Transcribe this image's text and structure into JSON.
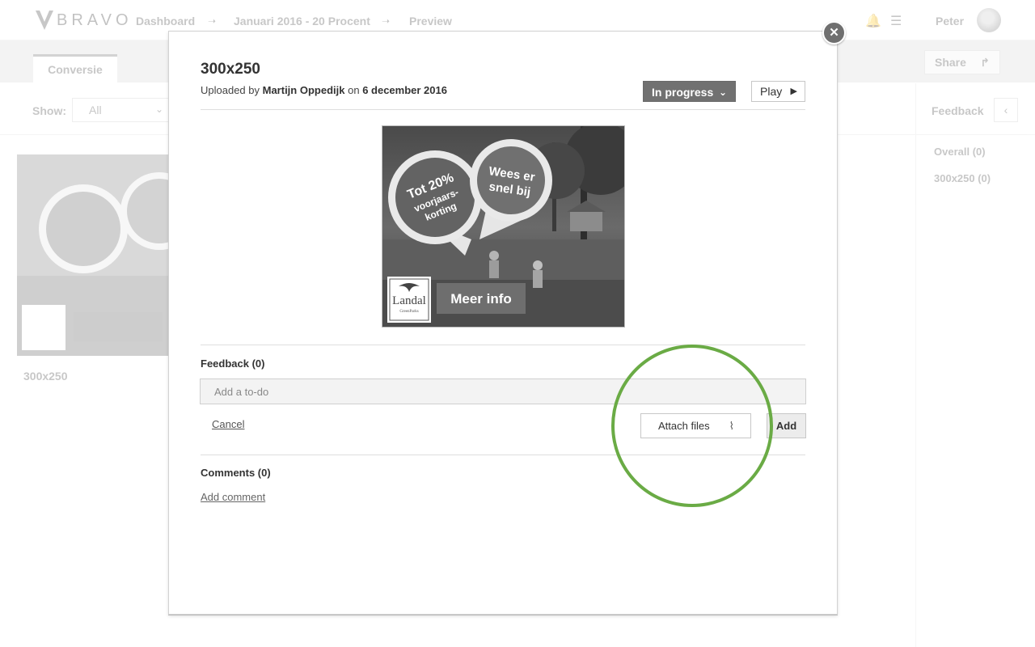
{
  "app": {
    "brand": "BRAVO",
    "breadcrumbs": [
      "Dashboard",
      "Januari 2016 - 20 Procent",
      "Preview"
    ],
    "user_name": "Peter"
  },
  "tabs": {
    "active": "Conversie"
  },
  "toolbar": {
    "share_label": "Share"
  },
  "filter": {
    "show_label": "Show:",
    "show_value": "All"
  },
  "sidebar": {
    "title": "Feedback",
    "items": [
      {
        "label": "Overall (0)"
      },
      {
        "label": "300x250 (0)"
      }
    ]
  },
  "grid": {
    "cards": [
      {
        "label": "300x250"
      }
    ]
  },
  "modal": {
    "title": "300x250",
    "meta": {
      "prefix": "Uploaded by",
      "author": "Martijn Oppedijk",
      "on": "on",
      "date": "6 december 2016"
    },
    "status_label": "In progress",
    "play_label": "Play",
    "banner": {
      "badge_left": [
        "Tot 20%",
        "voorjaars-",
        "korting"
      ],
      "badge_right": [
        "Wees er",
        "snel bij"
      ],
      "cta": "Meer info",
      "logo_text": "Landal",
      "logo_sub": "GreenParks"
    },
    "feedback": {
      "title": "Feedback (0)",
      "todo_placeholder": "Add a to-do",
      "cancel_label": "Cancel",
      "attach_label": "Attach files",
      "add_label": "Add"
    },
    "comments": {
      "title": "Comments (0)",
      "add_label": "Add comment"
    }
  },
  "colors": {
    "highlight": "#6aab45",
    "status_bg": "#717171"
  },
  "icons": [
    "bell-icon",
    "menu-icon",
    "share-arrow-icon",
    "chevron-down-icon",
    "chevron-left-icon",
    "play-icon",
    "paperclip-icon",
    "close-icon",
    "pin-icon"
  ]
}
